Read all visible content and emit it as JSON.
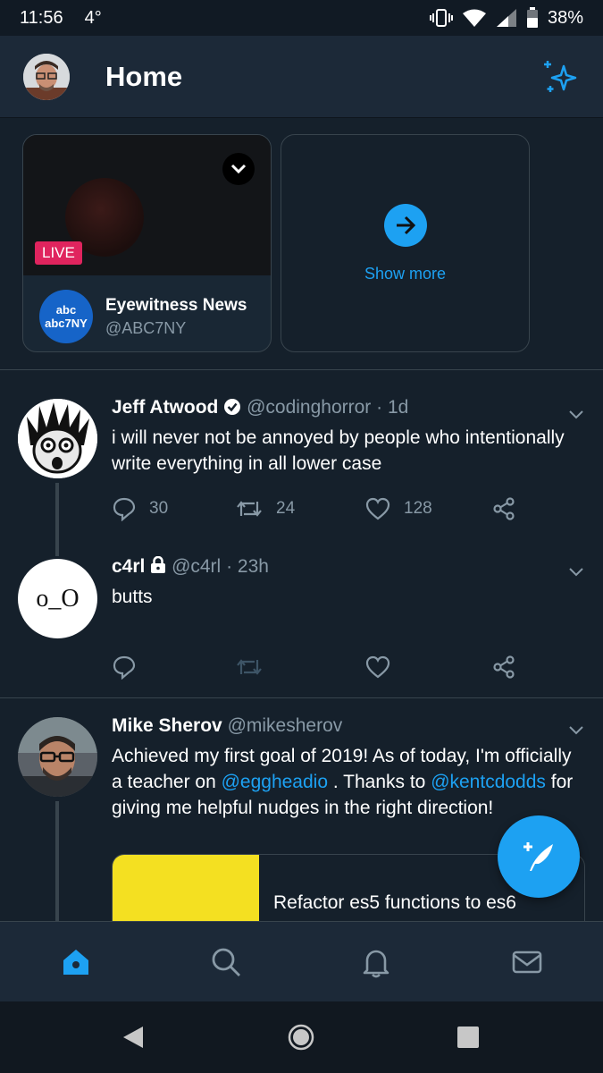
{
  "status_bar": {
    "time": "11:56",
    "temp": "4°",
    "battery": "38%"
  },
  "header": {
    "title": "Home",
    "profile_icon": "profile-avatar",
    "sparkle_icon": "sparkle-icon"
  },
  "live_card": {
    "badge": "LIVE",
    "name": "Eyewitness News",
    "handle": "@ABC7NY",
    "logo_top": "abc",
    "logo_bottom": "abc7NY"
  },
  "show_more": {
    "label": "Show more"
  },
  "tweets": [
    {
      "name": "Jeff Atwood",
      "handle": "@codinghorror",
      "time": "· 1d",
      "text": "i will never not be annoyed by people who intentionally write everything in all lower case",
      "replies": "30",
      "retweets": "24",
      "likes": "128"
    },
    {
      "name": "c4rl",
      "handle": "@c4rl",
      "time": "· 23h",
      "text": "butts",
      "avatar_text": "o_O",
      "replies": "",
      "retweets": "",
      "likes": ""
    },
    {
      "name": "Mike Sherov",
      "handle": "@mikesherov",
      "time": "",
      "text_part1": "Achieved my first goal of 2019! As of today, I'm officially a teacher on ",
      "mention1": "@eggheadio",
      "text_part2": " . Thanks to ",
      "mention2": "@kentcdodds",
      "text_part3": " for giving me helpful nudges in the right direction!",
      "link_title": "Refactor es5 functions to es6"
    }
  ],
  "colors": {
    "accent": "#1da1f2",
    "background": "#15202b",
    "header": "#1c2938",
    "muted": "#8899a6",
    "live": "#e0245e"
  }
}
